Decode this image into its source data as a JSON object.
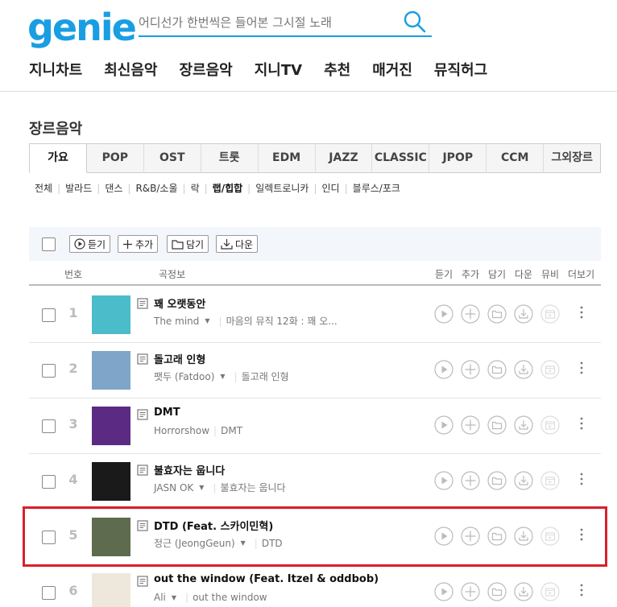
{
  "logo": {
    "text": "genie"
  },
  "search": {
    "placeholder": "어디선가 한번씩은 들어본 그시절 노래"
  },
  "gnb": [
    "지니차트",
    "최신음악",
    "장르음악",
    "지니TV",
    "추천",
    "매거진",
    "뮤직허그"
  ],
  "page_title": "장르음악",
  "tabs": [
    "가요",
    "POP",
    "OST",
    "트롯",
    "EDM",
    "JAZZ",
    "CLASSIC",
    "JPOP",
    "CCM",
    "그외장르"
  ],
  "active_tab": "가요",
  "subgenres": [
    "전체",
    "발라드",
    "댄스",
    "R&B/소울",
    "락",
    "랩/힙합",
    "일렉트로니카",
    "인디",
    "블루스/포크"
  ],
  "active_subgenre": "랩/힙합",
  "toolbar": {
    "play": "듣기",
    "add": "추가",
    "save": "담기",
    "download": "다운"
  },
  "table_header": {
    "number": "번호",
    "song_info": "곡정보",
    "play": "듣기",
    "add": "추가",
    "save": "담기",
    "download": "다운",
    "mv": "뮤비",
    "more": "더보기"
  },
  "songs": [
    {
      "rank": "1",
      "title": "꽤 오랫동안",
      "artist": "The mind",
      "album": "마음의 뮤직 12화 : 꽤 오...",
      "artist_dropdown": true,
      "cover": "#4bbcc9"
    },
    {
      "rank": "2",
      "title": "돌고래 인형",
      "artist": "팻두 (Fatdoo)",
      "album": "돌고래 인형",
      "artist_dropdown": true,
      "cover": "#7fa6c9"
    },
    {
      "rank": "3",
      "title": "DMT",
      "artist": "Horrorshow",
      "album": "DMT",
      "artist_dropdown": false,
      "cover": "#5b2a83"
    },
    {
      "rank": "4",
      "title": "불효자는 웁니다",
      "artist": "JASN OK",
      "album": "불효자는 웁니다",
      "artist_dropdown": true,
      "cover": "#1a1a1a"
    },
    {
      "rank": "5",
      "title": "DTD (Feat. 스카이민혁)",
      "artist": "정근 (JeongGeun)",
      "album": "DTD",
      "artist_dropdown": true,
      "cover": "#5e6b4e"
    },
    {
      "rank": "6",
      "title": "out the window (Feat. Itzel & oddbob)",
      "artist": "Ali",
      "album": "out the window",
      "artist_dropdown": true,
      "cover": "#eee8dc"
    }
  ],
  "colors": {
    "brand": "#1a9ee2",
    "highlight": "#d9202c"
  }
}
